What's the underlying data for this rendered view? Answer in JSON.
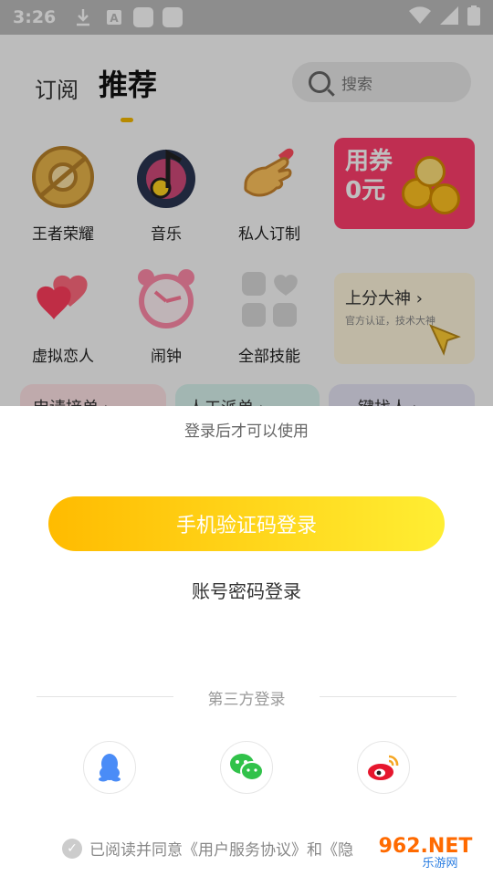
{
  "status_bar": {
    "time": "3:26"
  },
  "app": {
    "tabs": [
      {
        "label": "订阅"
      },
      {
        "label": "推荐"
      }
    ],
    "search": {
      "placeholder": "搜索"
    },
    "grid": [
      {
        "label": "王者荣耀",
        "icon": "honor-of-kings-icon"
      },
      {
        "label": "音乐",
        "icon": "music-note-icon"
      },
      {
        "label": "私人订制",
        "icon": "finger-heart-icon"
      },
      {
        "label": "虚拟恋人",
        "icon": "hearts-icon"
      },
      {
        "label": "闹钟",
        "icon": "alarm-clock-icon"
      },
      {
        "label": "全部技能",
        "icon": "all-skills-icon"
      }
    ],
    "banner_coupon": {
      "text_line1": "用券",
      "text_line2": "0元"
    },
    "banner_master": {
      "title": "上分大神 ›",
      "subtitle": "官方认证，技术大神"
    },
    "pills": [
      {
        "label": "申请接单 ›"
      },
      {
        "label": "人工派单 ›"
      },
      {
        "label": "键找人 ›"
      }
    ]
  },
  "sheet": {
    "hint": "登录后才可以使用",
    "phone_login_label": "手机验证码登录",
    "account_login_label": "账号密码登录",
    "third_party_label": "第三方登录",
    "social": [
      {
        "icon": "qq-icon"
      },
      {
        "icon": "wechat-icon"
      },
      {
        "icon": "weibo-icon"
      }
    ],
    "agreement": "已阅读并同意《用户服务协议》和《隐"
  },
  "watermark": {
    "text": "962.NET",
    "sub": "乐游网"
  },
  "colors": {
    "accent": "#ffcc00",
    "qq": "#4a8cf7",
    "wechat": "#31c24a",
    "weibo": "#e6162d"
  }
}
